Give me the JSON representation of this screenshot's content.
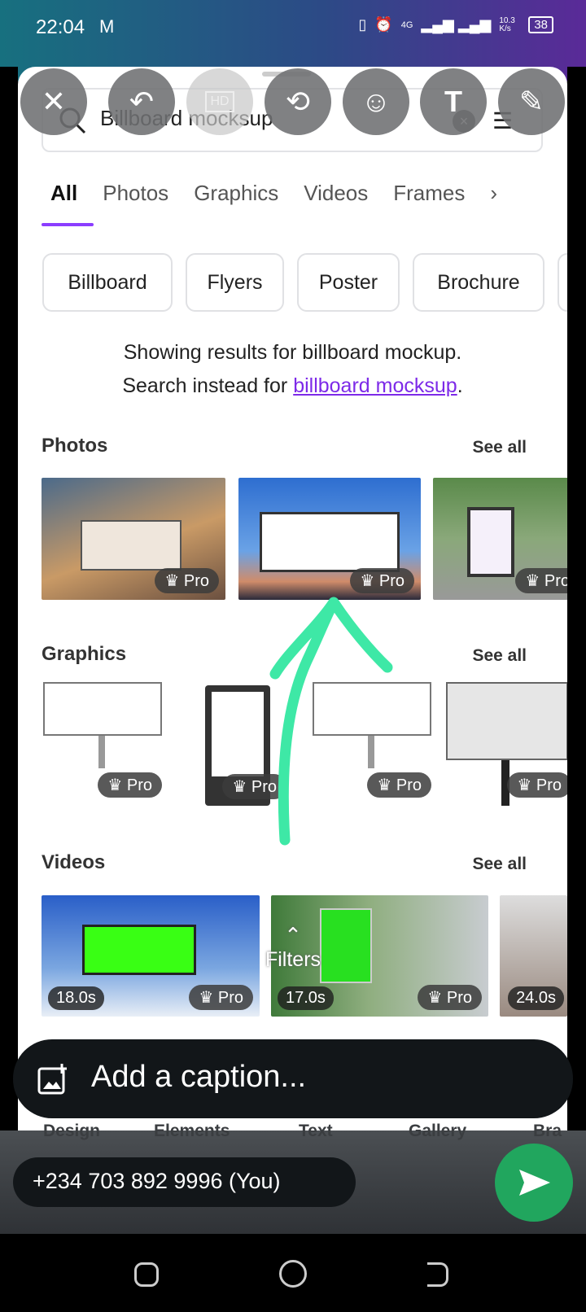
{
  "status_bar": {
    "time": "22:04",
    "network": "4G",
    "speed": "10.3 K/s",
    "battery": "38"
  },
  "editor_tools": [
    {
      "icon": "close-icon"
    },
    {
      "icon": "undo-icon"
    },
    {
      "icon": "hd-icon",
      "label": "HD"
    },
    {
      "icon": "crop-rotate-icon"
    },
    {
      "icon": "sticker-icon"
    },
    {
      "icon": "text-icon",
      "label": "T"
    },
    {
      "icon": "pencil-icon"
    }
  ],
  "search": {
    "value": "Billboard mocksup"
  },
  "tabs": [
    "All",
    "Photos",
    "Graphics",
    "Videos",
    "Frames"
  ],
  "chips": [
    "Billboard",
    "Flyers",
    "Poster",
    "Brochure"
  ],
  "correction": {
    "line1": "Showing results for billboard mockup.",
    "prefix": "Search instead for ",
    "link": "billboard mocksup",
    "suffix": "."
  },
  "sections": {
    "photos": "Photos",
    "graphics": "Graphics",
    "videos": "Videos",
    "see_all": "See all"
  },
  "badge_pro": "Pro",
  "videos": [
    {
      "duration": "18.0s"
    },
    {
      "duration": "17.0s"
    },
    {
      "duration": "24.0s"
    }
  ],
  "filters": "Filters",
  "bottom_tabs": [
    "Design",
    "Elements",
    "Text",
    "Gallery",
    "Bra"
  ],
  "caption": {
    "placeholder": "Add a caption..."
  },
  "recipient": "+234 703 892 9996 (You)",
  "colors": {
    "accent": "#8b3dff",
    "send": "#21a65e",
    "annotation": "#3ee8a6"
  }
}
